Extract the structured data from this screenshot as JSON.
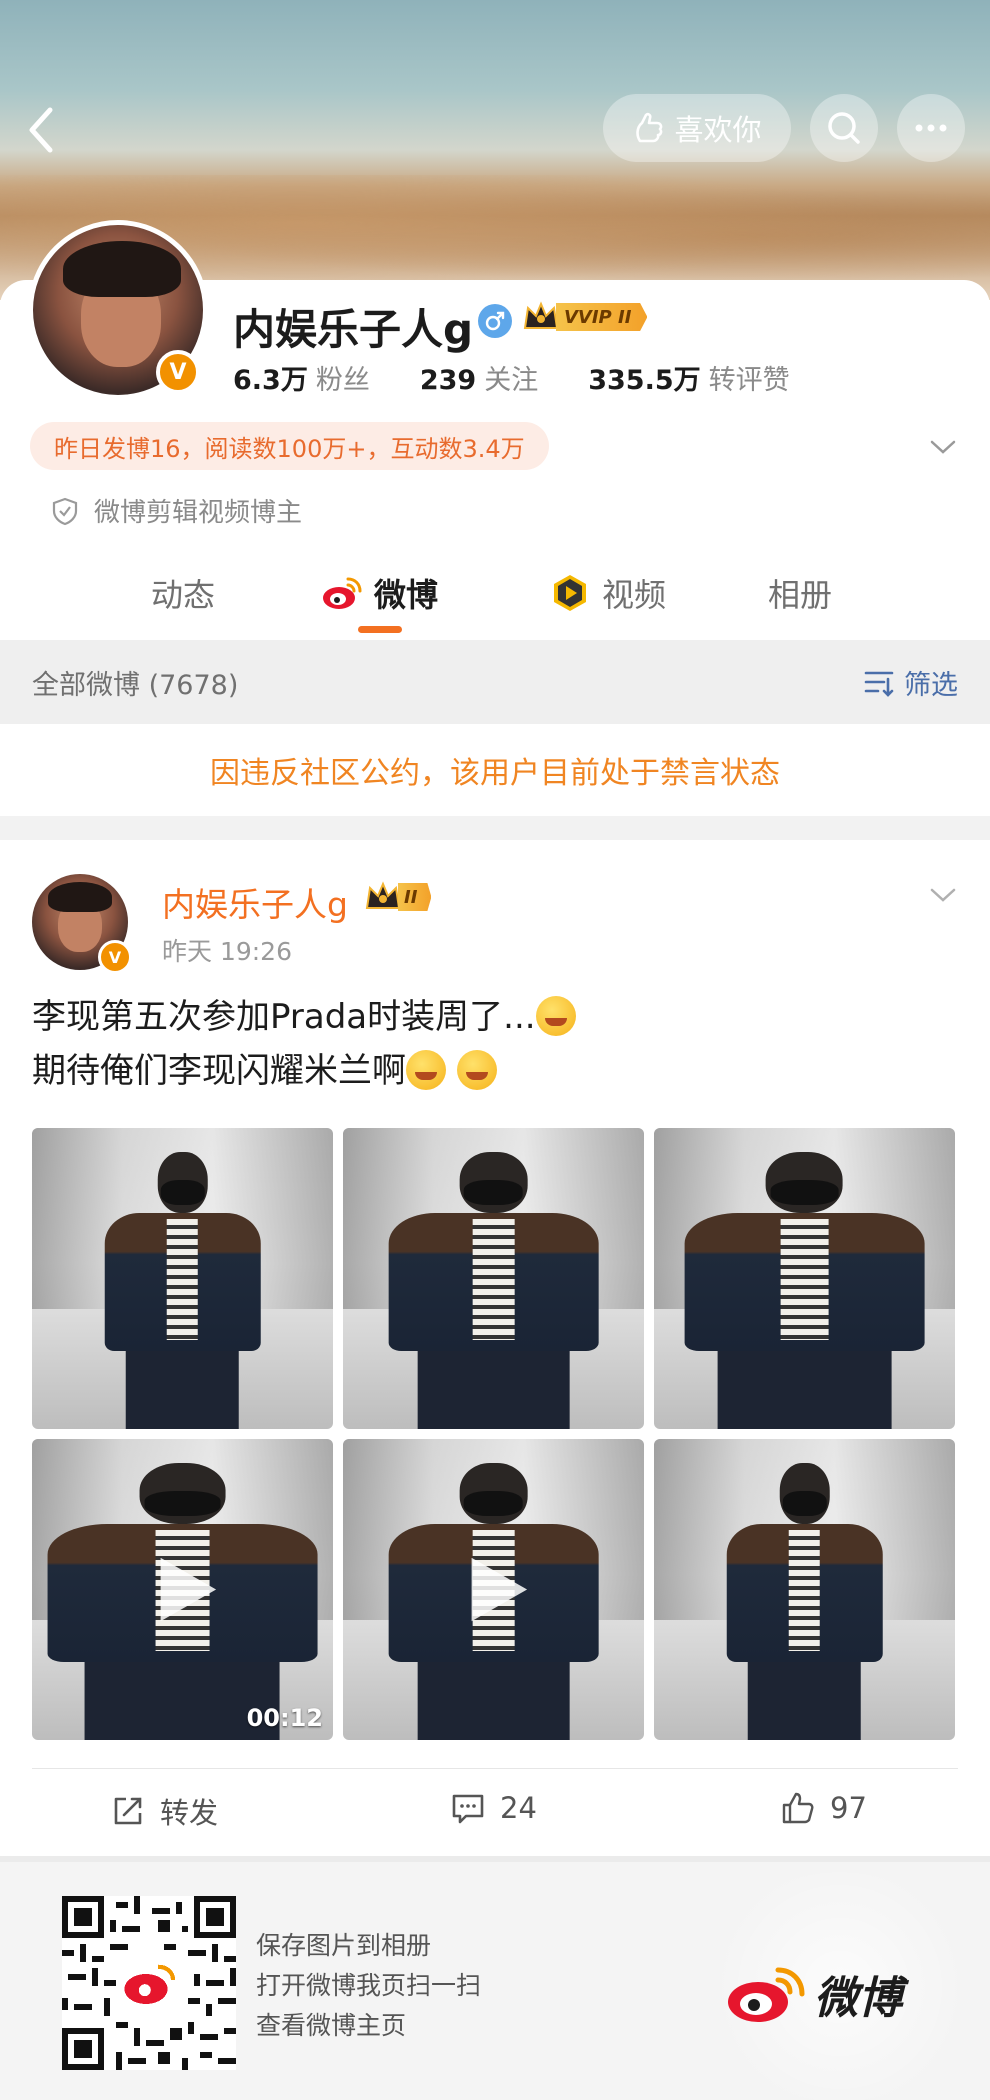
{
  "header": {
    "like_label": "喜欢你",
    "icons": [
      "back-icon",
      "heart-hand-icon",
      "search-icon",
      "more-icon"
    ]
  },
  "profile": {
    "name": "内娱乐子人g",
    "vip_tag": "VVIP II",
    "stats": [
      {
        "num": "6.3万",
        "label": "粉丝"
      },
      {
        "num": "239",
        "label": "关注"
      },
      {
        "num": "335.5万",
        "label": "转评赞"
      }
    ],
    "activity": "昨日发博16，阅读数100万+，互动数3.4万",
    "certification": "微博剪辑视频博主"
  },
  "tabs": [
    {
      "label": "动态"
    },
    {
      "label": "微博"
    },
    {
      "label": "视频"
    },
    {
      "label": "相册"
    }
  ],
  "filterbar": {
    "all_label": "全部微博 (7678)",
    "filter_label": "筛选"
  },
  "ban_notice": "因违反社区公约，该用户目前处于禁言状态",
  "post": {
    "author": "内娱乐子人g",
    "vip_tag": "II",
    "time": "昨天 19:26",
    "line1": "李现第五次参加Prada时装周了...",
    "line2": "期待俺们李现闪耀米兰啊",
    "video_duration": "00:12",
    "actions": {
      "repost": "转发",
      "comments": "24",
      "likes": "97"
    }
  },
  "footer": {
    "lines": [
      "保存图片到相册",
      "打开微博我页扫一扫",
      "查看微博主页"
    ],
    "brand": "微博"
  },
  "colors": {
    "accent": "#f37021",
    "link_blue": "#4a6ea9",
    "ban_text": "#f08522",
    "activity_text": "#e86b2e"
  }
}
